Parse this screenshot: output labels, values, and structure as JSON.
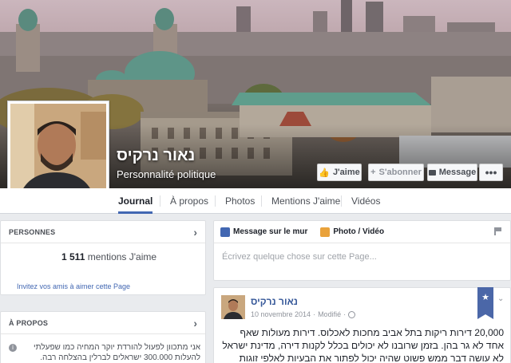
{
  "page": {
    "name": "נאור נרקיס",
    "category": "Personnalité politique"
  },
  "actions": {
    "like": "J'aime",
    "subscribe": "S'abonner",
    "message": "Message",
    "more": "•••"
  },
  "tabs": [
    {
      "label": "Journal"
    },
    {
      "label": "À propos"
    },
    {
      "label": "Photos"
    },
    {
      "label": "Mentions J'aime"
    },
    {
      "label": "Vidéos"
    }
  ],
  "people": {
    "title": "PERSONNES",
    "count": "1 511",
    "count_suffix": "mentions J'aime",
    "invite": "Invitez vos amis à aimer cette Page"
  },
  "about": {
    "title": "À PROPOS",
    "text": "אני מתכוון לפעול להורדת יוקר המחיה כמו שפעלתי להעלות 300.000 ישראלים לברלין בהצלחה רבה."
  },
  "composer": {
    "tab_status": "Message sur le mur",
    "tab_photo": "Photo / Vidéo",
    "placeholder": "Écrivez quelque chose sur cette Page..."
  },
  "post": {
    "author": "נאור נרקיס",
    "date": "10 novembre 2014",
    "edited": "Modifié",
    "text": "20,000 דירות ריקות בתל אביב מחכות לאכלוס. דירות מעולות שאף אחד לא גר בהן. בזמן שרובנו לא יכולים בכלל לקנות דירה, מדינת ישראל לא עושה דבר ממש פשוט שהיה יכול לפתור את הבעיות לאלפי זוגות צעירים"
  },
  "colors": {
    "accent": "#4267b2",
    "bookmark": "#4b67a8"
  }
}
